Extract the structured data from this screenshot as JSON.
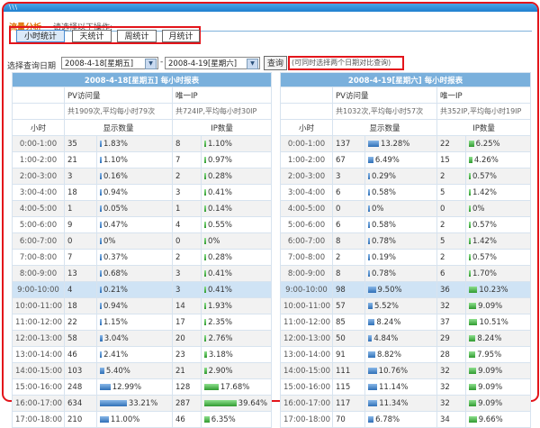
{
  "topbar": "\\\\\\",
  "header": {
    "title": "流量分析",
    "hint": "请选择以下操作:"
  },
  "tabs": [
    {
      "label": "小时统计",
      "active": true
    },
    {
      "label": "天统计",
      "active": false
    },
    {
      "label": "周统计",
      "active": false
    },
    {
      "label": "月统计",
      "active": false
    }
  ],
  "query": {
    "label": "选择查询日期",
    "date1": "2008-4-18[星期五]",
    "separator": "-",
    "date2": "2008-4-19[星期六]",
    "button": "查询",
    "note": "(可同时选择两个日期对比查询)"
  },
  "colors": {
    "red": "#e3151b",
    "header_blue": "#7ab0dc",
    "bar_blue": "#2f6fb6",
    "bar_green": "#2f9a2f"
  },
  "left": {
    "caption": "2008-4-18[星期五] 每小时报表",
    "pv_title": "PV访问量",
    "ip_title": "唯一IP",
    "pv_note": "共1909次,平均每小时79次",
    "ip_note": "共724IP,平均每小时30IP",
    "col_hour": "小时",
    "col_pv": "显示数量",
    "col_ip": "IP数量",
    "rows": [
      [
        "0:00-1:00",
        "35",
        "1.83%",
        1.83,
        "8",
        "1.10%",
        1.1
      ],
      [
        "1:00-2:00",
        "21",
        "1.10%",
        1.1,
        "7",
        "0.97%",
        0.97
      ],
      [
        "2:00-3:00",
        "3",
        "0.16%",
        0.16,
        "2",
        "0.28%",
        0.28
      ],
      [
        "3:00-4:00",
        "18",
        "0.94%",
        0.94,
        "3",
        "0.41%",
        0.41
      ],
      [
        "4:00-5:00",
        "1",
        "0.05%",
        0.05,
        "1",
        "0.14%",
        0.14
      ],
      [
        "5:00-6:00",
        "9",
        "0.47%",
        0.47,
        "4",
        "0.55%",
        0.55
      ],
      [
        "6:00-7:00",
        "0",
        "0%",
        0,
        "0",
        "0%",
        0
      ],
      [
        "7:00-8:00",
        "7",
        "0.37%",
        0.37,
        "2",
        "0.28%",
        0.28
      ],
      [
        "8:00-9:00",
        "13",
        "0.68%",
        0.68,
        "3",
        "0.41%",
        0.41
      ],
      [
        "9:00-10:00",
        "4",
        "0.21%",
        0.21,
        "3",
        "0.41%",
        0.41
      ],
      [
        "10:00-11:00",
        "18",
        "0.94%",
        0.94,
        "14",
        "1.93%",
        1.93
      ],
      [
        "11:00-12:00",
        "22",
        "1.15%",
        1.15,
        "17",
        "2.35%",
        2.35
      ],
      [
        "12:00-13:00",
        "58",
        "3.04%",
        3.04,
        "20",
        "2.76%",
        2.76
      ],
      [
        "13:00-14:00",
        "46",
        "2.41%",
        2.41,
        "23",
        "3.18%",
        3.18
      ],
      [
        "14:00-15:00",
        "103",
        "5.40%",
        5.4,
        "21",
        "2.90%",
        2.9
      ],
      [
        "15:00-16:00",
        "248",
        "12.99%",
        12.99,
        "128",
        "17.68%",
        17.68
      ],
      [
        "16:00-17:00",
        "634",
        "33.21%",
        33.21,
        "287",
        "39.64%",
        39.64
      ],
      [
        "17:00-18:00",
        "210",
        "11.00%",
        11.0,
        "46",
        "6.35%",
        6.35
      ]
    ]
  },
  "right": {
    "caption": "2008-4-19[星期六] 每小时报表",
    "pv_title": "PV访问量",
    "ip_title": "唯一IP",
    "pv_note": "共1032次,平均每小时57次",
    "ip_note": "共352IP,平均每小时19IP",
    "col_hour": "小时",
    "col_pv": "显示数量",
    "col_ip": "IP数量",
    "rows": [
      [
        "0:00-1:00",
        "137",
        "13.28%",
        13.28,
        "22",
        "6.25%",
        6.25
      ],
      [
        "1:00-2:00",
        "67",
        "6.49%",
        6.49,
        "15",
        "4.26%",
        4.26
      ],
      [
        "2:00-3:00",
        "3",
        "0.29%",
        0.29,
        "2",
        "0.57%",
        0.57
      ],
      [
        "3:00-4:00",
        "6",
        "0.58%",
        0.58,
        "5",
        "1.42%",
        1.42
      ],
      [
        "4:00-5:00",
        "0",
        "0%",
        0,
        "0",
        "0%",
        0
      ],
      [
        "5:00-6:00",
        "6",
        "0.58%",
        0.58,
        "2",
        "0.57%",
        0.57
      ],
      [
        "6:00-7:00",
        "8",
        "0.78%",
        0.78,
        "5",
        "1.42%",
        1.42
      ],
      [
        "7:00-8:00",
        "2",
        "0.19%",
        0.19,
        "2",
        "0.57%",
        0.57
      ],
      [
        "8:00-9:00",
        "8",
        "0.78%",
        0.78,
        "6",
        "1.70%",
        1.7
      ],
      [
        "9:00-10:00",
        "98",
        "9.50%",
        9.5,
        "36",
        "10.23%",
        10.23
      ],
      [
        "10:00-11:00",
        "57",
        "5.52%",
        5.52,
        "32",
        "9.09%",
        9.09
      ],
      [
        "11:00-12:00",
        "85",
        "8.24%",
        8.24,
        "37",
        "10.51%",
        10.51
      ],
      [
        "12:00-13:00",
        "50",
        "4.84%",
        4.84,
        "29",
        "8.24%",
        8.24
      ],
      [
        "13:00-14:00",
        "91",
        "8.82%",
        8.82,
        "28",
        "7.95%",
        7.95
      ],
      [
        "14:00-15:00",
        "111",
        "10.76%",
        10.76,
        "32",
        "9.09%",
        9.09
      ],
      [
        "15:00-16:00",
        "115",
        "11.14%",
        11.14,
        "32",
        "9.09%",
        9.09
      ],
      [
        "16:00-17:00",
        "117",
        "11.34%",
        11.34,
        "32",
        "9.09%",
        9.09
      ],
      [
        "17:00-18:00",
        "70",
        "6.78%",
        6.78,
        "34",
        "9.66%",
        9.66
      ]
    ]
  }
}
